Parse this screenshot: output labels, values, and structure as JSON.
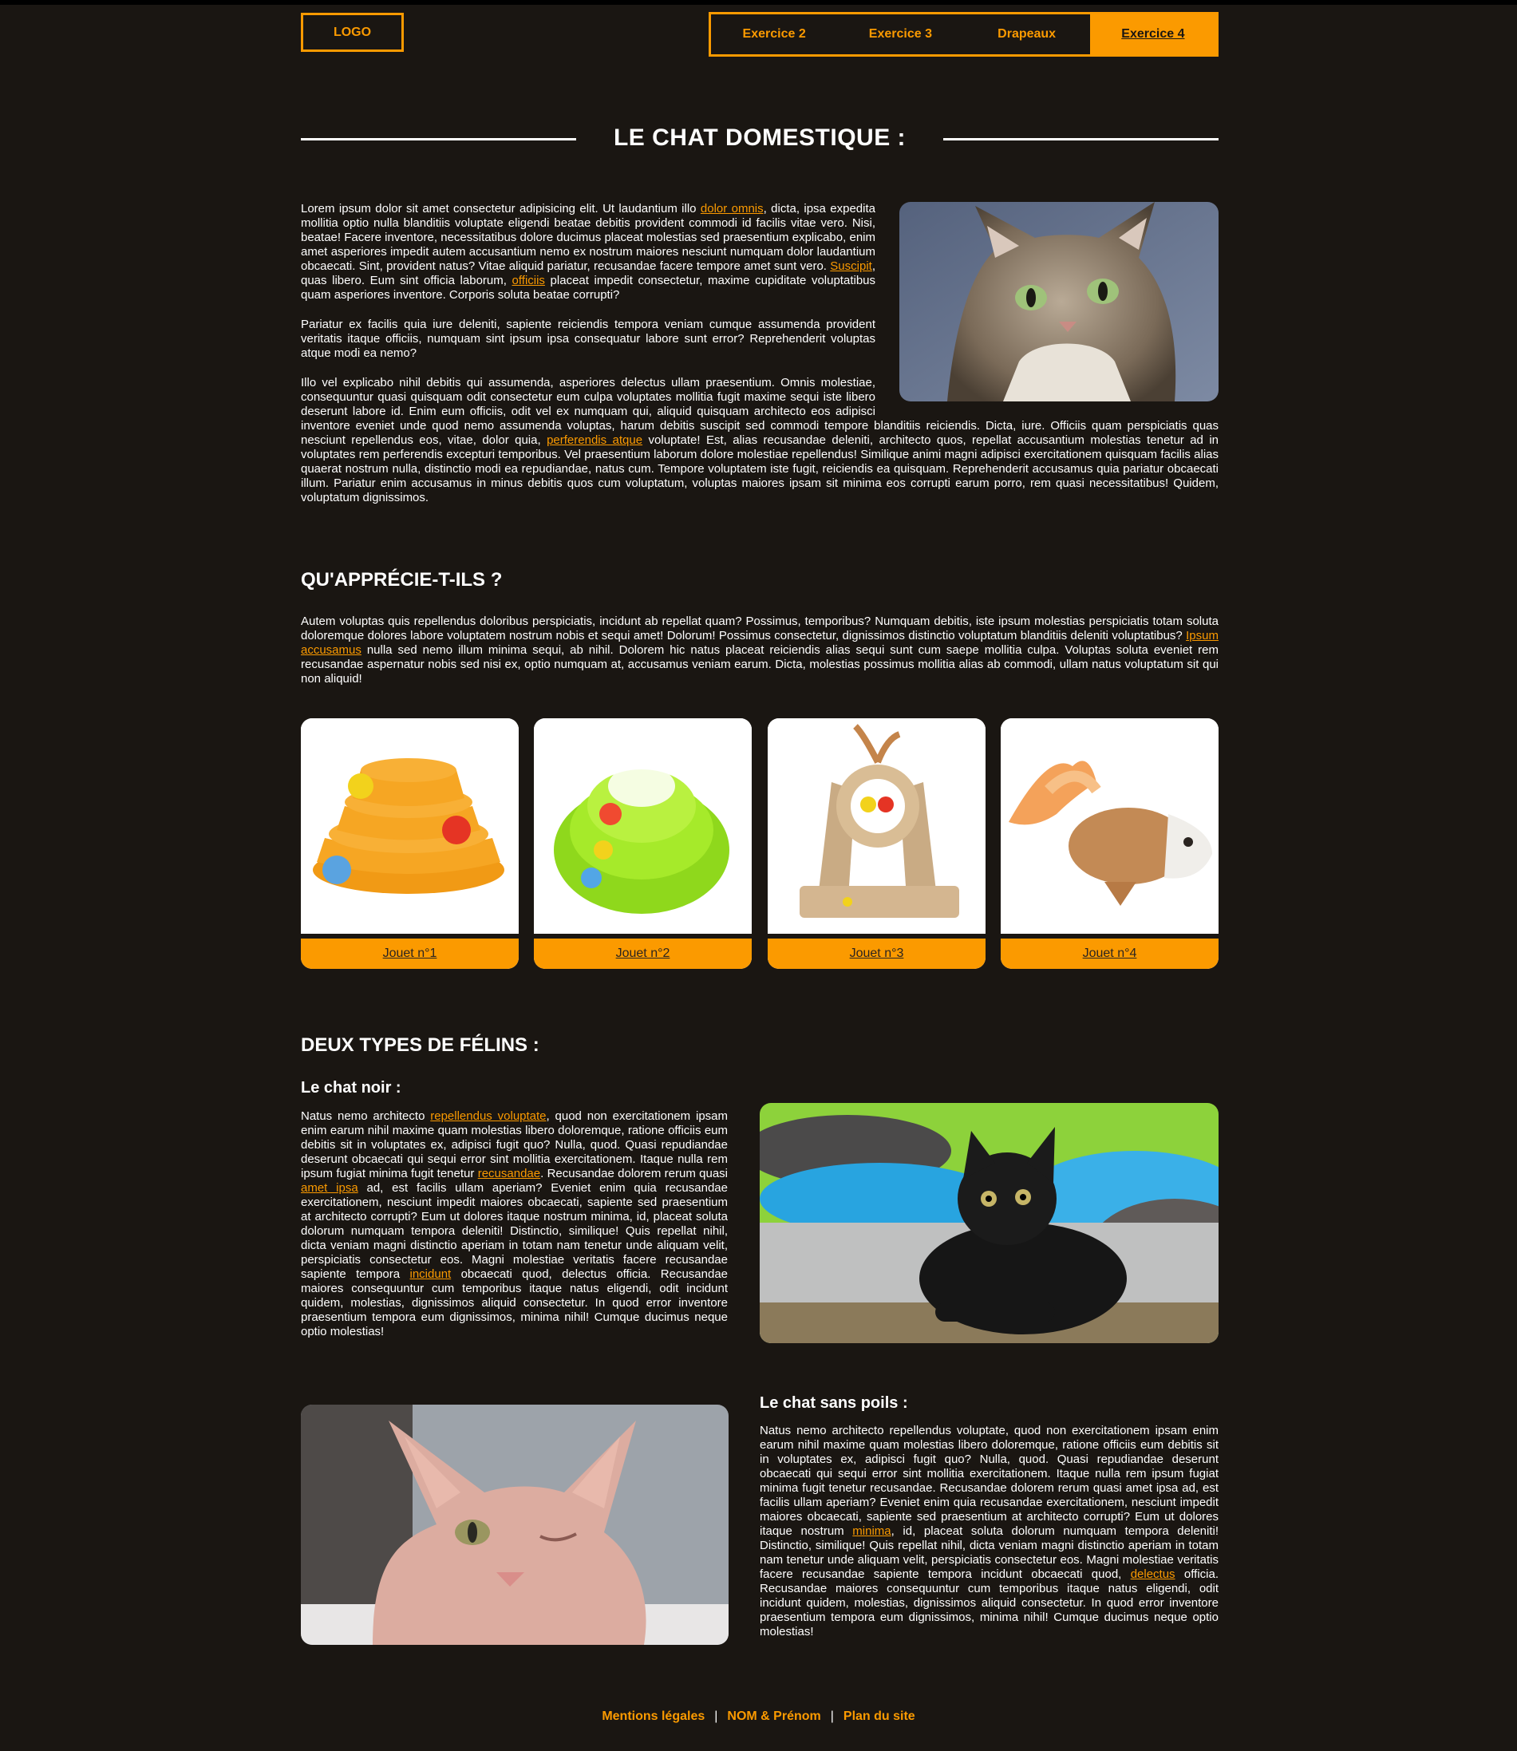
{
  "header": {
    "logo": "LOGO",
    "nav": [
      "Exercice 2",
      "Exercice 3",
      "Drapeaux",
      "Exercice 4"
    ],
    "active_index": 3
  },
  "title": "LE CHAT DOMESTIQUE :",
  "intro": {
    "p1_a": "Lorem ipsum dolor sit amet consectetur adipisicing elit. Ut laudantium illo ",
    "p1_link1": "dolor omnis",
    "p1_b": ", dicta, ipsa expedita mollitia optio nulla blanditiis voluptate eligendi beatae debitis provident commodi id facilis vitae vero. Nisi, beatae! Facere inventore, necessitatibus dolore ducimus placeat molestias sed praesentium explicabo, enim amet asperiores impedit autem accusantium nemo ex nostrum maiores nesciunt numquam dolor laudantium obcaecati. Sint, provident natus? Vitae aliquid pariatur, recusandae facere tempore amet sunt vero. ",
    "p1_link2": "Suscipit",
    "p1_c": ", quas libero. Eum sint officia laborum, ",
    "p1_link3": "officiis",
    "p1_d": " placeat impedit consectetur, maxime cupiditate voluptatibus quam asperiores inventore. Corporis soluta beatae corrupti?",
    "p2": "Pariatur ex facilis quia iure deleniti, sapiente reiciendis tempora veniam cumque assumenda provident veritatis itaque officiis, numquam sint ipsum ipsa consequatur labore sunt error? Reprehenderit voluptas atque modi ea nemo?",
    "p3_a": "Illo vel explicabo nihil debitis qui assumenda, asperiores delectus ullam praesentium. Omnis molestiae, consequuntur quasi quisquam odit consectetur eum culpa voluptates mollitia fugit maxime sequi iste libero deserunt labore id. Enim eum officiis, odit vel ex numquam qui, aliquid quisquam architecto eos adipisci inventore eveniet unde quod nemo assumenda voluptas, harum debitis suscipit sed commodi tempore blanditiis reiciendis. Dicta, iure. Officiis quam perspiciatis quas nesciunt repellendus eos, vitae, dolor quia, ",
    "p3_link": "perferendis atque",
    "p3_b": " voluptate! Est, alias recusandae deleniti, architecto quos, repellat accusantium molestias tenetur ad in voluptates rem perferendis excepturi temporibus. Vel praesentium laborum dolore molestiae repellendus! Similique animi magni adipisci exercitationem quisquam facilis alias quaerat nostrum nulla, distinctio modi ea repudiandae, natus cum. Tempore voluptatem iste fugit, reiciendis ea quisquam. Reprehenderit accusamus quia pariatur obcaecati illum. Pariatur enim accusamus in minus debitis quos cum voluptatum, voluptas maiores ipsam sit minima eos corrupti earum porro, rem quasi necessitatibus! Quidem, voluptatum dignissimos."
  },
  "likes": {
    "heading": "QU'APPRÉCIE-T-ILS ?",
    "text_a": "Autem voluptas quis repellendus doloribus perspiciatis, incidunt ab repellat quam? Possimus, temporibus? Numquam debitis, iste ipsum molestias perspiciatis totam soluta doloremque dolores labore voluptatem nostrum nobis et sequi amet! Dolorum! Possimus consectetur, dignissimos distinctio voluptatum blanditiis deleniti voluptatibus? ",
    "text_link": "Ipsum accusamus",
    "text_b": " nulla sed nemo illum minima sequi, ab nihil. Dolorem hic natus placeat reiciendis alias sequi sunt cum saepe mollitia culpa. Voluptas soluta eveniet rem recusandae aspernatur nobis sed nisi ex, optio numquam at, accusamus veniam earum. Dicta, molestias possimus mollitia alias ab commodi, ullam natus voluptatum sit qui non aliquid!",
    "toys": [
      "Jouet n°1",
      "Jouet n°2",
      "Jouet n°3",
      "Jouet n°4"
    ]
  },
  "types": {
    "heading": "DEUX TYPES DE FÉLINS :",
    "black": {
      "heading": "Le chat noir :",
      "a": "Natus nemo architecto ",
      "l1": "repellendus voluptate",
      "b": ", quod non exercitationem ipsam enim earum nihil maxime quam molestias libero doloremque, ratione officiis eum debitis sit in voluptates ex, adipisci fugit quo? Nulla, quod. Quasi repudiandae deserunt obcaecati qui sequi error sint mollitia exercitationem. Itaque nulla rem ipsum fugiat minima fugit tenetur ",
      "l2": "recusandae",
      "c": ". Recusandae dolorem rerum quasi ",
      "l3": "amet ipsa",
      "d": " ad, est facilis ullam aperiam? Eveniet enim quia recusandae exercitationem, nesciunt impedit maiores obcaecati, sapiente sed praesentium at architecto corrupti? Eum ut dolores itaque nostrum minima, id, placeat soluta dolorum numquam tempora deleniti! Distinctio, similique! Quis repellat nihil, dicta veniam magni distinctio aperiam in totam nam tenetur unde aliquam velit, perspiciatis consectetur eos. Magni molestiae veritatis facere recusandae sapiente tempora ",
      "l4": "incidunt",
      "e": " obcaecati quod, delectus officia. Recusandae maiores consequuntur cum temporibus itaque natus eligendi, odit incidunt quidem, molestias, dignissimos aliquid consectetur. In quod error inventore praesentium tempora eum dignissimos, minima nihil! Cumque ducimus neque optio molestias!"
    },
    "hairless": {
      "heading": "Le chat sans poils :",
      "a": "Natus nemo architecto repellendus voluptate, quod non exercitationem ipsam enim earum nihil maxime quam molestias libero doloremque, ratione officiis eum debitis sit in voluptates ex, adipisci fugit quo? Nulla, quod. Quasi repudiandae deserunt obcaecati qui sequi error sint mollitia exercitationem. Itaque nulla rem ipsum fugiat minima fugit tenetur recusandae. Recusandae dolorem rerum quasi amet ipsa ad, est facilis ullam aperiam? Eveniet enim quia recusandae exercitationem, nesciunt impedit maiores obcaecati, sapiente sed praesentium at architecto corrupti? Eum ut dolores itaque nostrum ",
      "l1": "minima",
      "b": ", id, placeat soluta dolorum numquam tempora deleniti! Distinctio, similique! Quis repellat nihil, dicta veniam magni distinctio aperiam in totam nam tenetur unde aliquam velit, perspiciatis consectetur eos. Magni molestiae veritatis facere recusandae sapiente tempora incidunt obcaecati quod, ",
      "l2": "delectus",
      "c": " officia. Recusandae maiores consequuntur cum temporibus itaque natus eligendi, odit incidunt quidem, molestias, dignissimos aliquid consectetur. In quod error inventore praesentium tempora eum dignissimos, minima nihil! Cumque ducimus neque optio molestias!"
    }
  },
  "footer": {
    "links": [
      "Mentions légales",
      "NOM & Prénom",
      "Plan du site"
    ],
    "separator": "|"
  },
  "colors": {
    "accent": "#fb9a00",
    "background": "#1a1612"
  }
}
